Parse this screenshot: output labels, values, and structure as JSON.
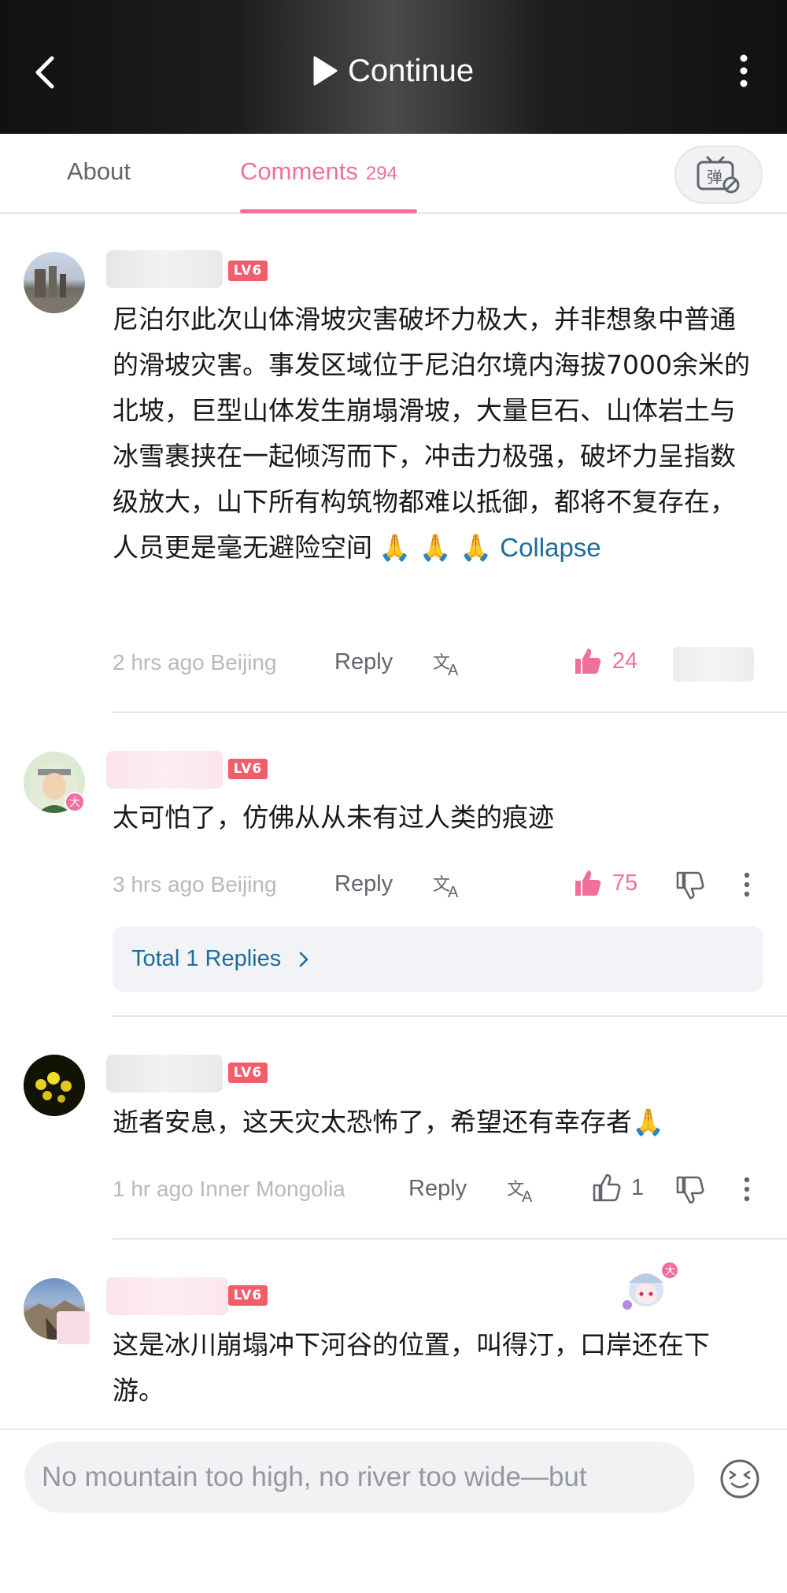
{
  "header": {
    "continue_label": "Continue"
  },
  "tabs": {
    "about": "About",
    "comments": "Comments",
    "comments_count": "294"
  },
  "comments": [
    {
      "level": "LV6",
      "text": "尼泊尔此次山体滑坡灾害破坏力极大，并非想象中普通的滑坡灾害。事发区域位于尼泊尔境内海拔7000余米的北坡，巨型山体发生崩塌滑坡，大量巨石、山体岩土与冰雪裹挟在一起倾泻而下，冲击力极强，破坏力呈指数级放大，山下所有构筑物都难以抵御，都将不复存在，人员更是毫无避险空间",
      "emoji": "🙏 🙏 🙏",
      "collapse": "Collapse",
      "time": "2 hrs ago Beijing",
      "reply": "Reply",
      "likes": "24"
    },
    {
      "level": "LV6",
      "text": "太可怕了，仿佛从从未有过人类的痕迹",
      "time": "3 hrs ago Beijing",
      "reply": "Reply",
      "likes": "75",
      "replies_label": "Total 1 Replies"
    },
    {
      "level": "LV6",
      "text": "逝者安息，这天灾太恐怖了，希望还有幸存者🙏",
      "time": "1 hr ago Inner Mongolia",
      "reply": "Reply",
      "likes": "1"
    },
    {
      "level": "LV6",
      "text": "这是冰川崩塌冲下河谷的位置，叫得汀，口岸还在下游。"
    }
  ],
  "composer": {
    "placeholder": "No mountain too high, no river too wide—but"
  },
  "colors": {
    "accent_pink": "#f06f9d",
    "link_blue": "#1f6c9c",
    "level_red": "#f25d6b"
  }
}
